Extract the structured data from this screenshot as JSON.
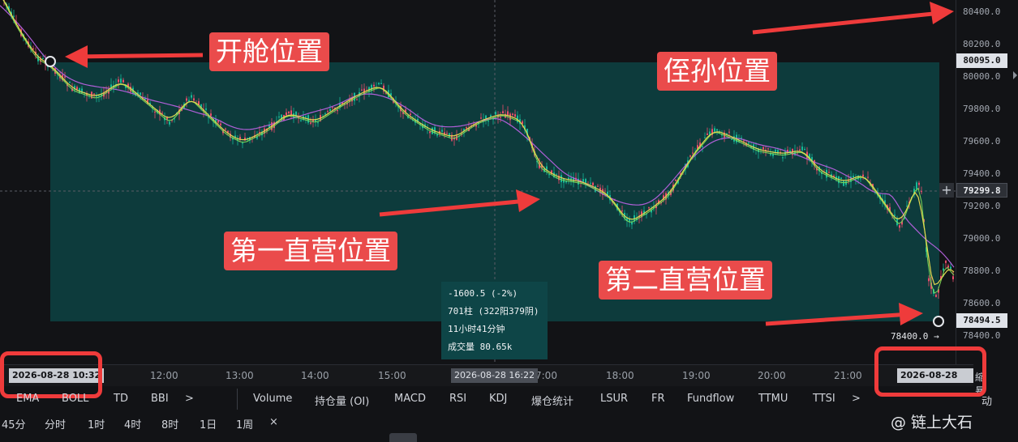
{
  "annotations": {
    "open_position": "开舱位置",
    "grandchild_position": "侄孙位置",
    "first_tp": "第一直营位置",
    "second_tp": "第二直营位置"
  },
  "price_axis": {
    "labels": [
      "80400.0",
      "80200.0",
      "80000.0",
      "79800.0",
      "79600.0",
      "79400.0",
      "79200.0",
      "79000.0",
      "78800.0",
      "78600.0",
      "78400.0"
    ],
    "tag_top": "80095.0",
    "tag_cross": "79299.8",
    "tag_bottom": "78494.5"
  },
  "chart": {
    "low_marker_label": "78400.0 →"
  },
  "time_axis": {
    "start_tag": "2026-08-28 10:32",
    "labels": [
      "12:00",
      "13:00",
      "14:00",
      "15:00",
      "7:00",
      "18:00",
      "19:00",
      "20:00",
      "21:00"
    ],
    "cursor_tag": "2026-08-28 16:22",
    "end_tag": "2026-08-28 22:13",
    "right_partial": "縮 暴"
  },
  "tooltip": {
    "change": "-1600.5 (-2%)",
    "bars": "701柱 (322阳379阴)",
    "duration": "11小时41分钟",
    "volume": "成交量 80.65k"
  },
  "indicators": {
    "items": [
      "EMA",
      "BOLL",
      "TD",
      "BBI",
      ">",
      "Volume",
      "持仓量 (OI)",
      "MACD",
      "RSI",
      "KDJ",
      "爆仓统计",
      "LSUR",
      "FR",
      "Fundflow",
      "TTMU",
      "TTSI",
      ">",
      "动"
    ]
  },
  "intervals": {
    "items": [
      "45分",
      "分时",
      "1时",
      "4时",
      "8时",
      "1日",
      "1周",
      "×"
    ]
  },
  "watermark": "@ 链上大石",
  "colors": {
    "background": "#121316",
    "range_box": "#0d3b3c",
    "up_candle": "#17b897",
    "down_candle": "#ea4d6b",
    "ma_yellow": "#e5d94f",
    "ma_green": "#7ed957",
    "ma_purple": "#b05fd8",
    "annotation_red": "#ea4b4b"
  }
}
